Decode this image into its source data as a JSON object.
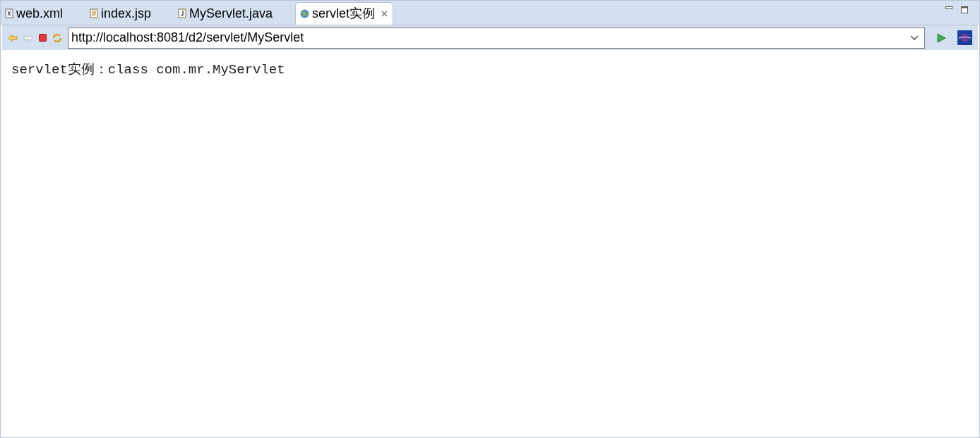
{
  "tabs": [
    {
      "label": "web.xml",
      "kind": "xml",
      "selected": false
    },
    {
      "label": "index.jsp",
      "kind": "jsp",
      "selected": false
    },
    {
      "label": "MyServlet.java",
      "kind": "java",
      "selected": false
    },
    {
      "label": "servlet实例",
      "kind": "web",
      "selected": true,
      "closable": true
    }
  ],
  "address_bar": {
    "value": "http://localhost:8081/d2/servlet/MyServlet"
  },
  "page": {
    "text": "servlet实例：class com.mr.MyServlet"
  }
}
